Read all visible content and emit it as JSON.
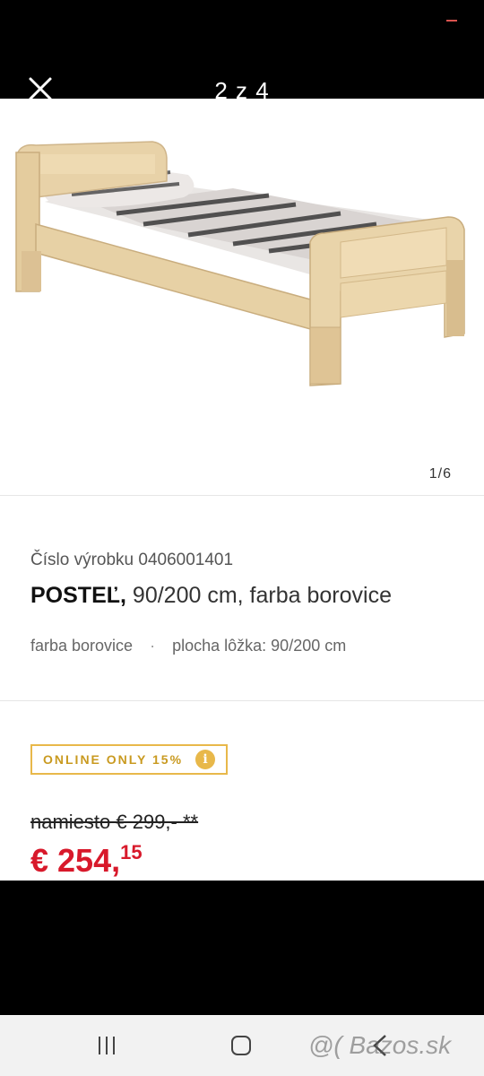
{
  "viewer": {
    "counter": "2 z 4",
    "close_icon": "close-icon",
    "accent_color": "#d9534f"
  },
  "gallery": {
    "image_index": "1/6"
  },
  "product": {
    "code": "Číslo výrobku 0406001401",
    "title_bold": "POSTEĽ,",
    "title_rest": "90/200 cm, farba borovice",
    "attributes": [
      "farba borovice",
      "plocha lôžka: 90/200 cm"
    ],
    "attribute_separator": "·"
  },
  "badge": {
    "text": "ONLINE ONLY 15%",
    "info_glyph": "i",
    "color": "#e8b84a"
  },
  "price": {
    "old": "namiesto € 299,- **",
    "new_main": "€ 254,",
    "new_cents": "15",
    "color": "#d8192b"
  },
  "watermark": "@( Bazos.sk",
  "navbar": {
    "recent_icon": "recent-apps-icon",
    "home_icon": "home-icon",
    "back_icon": "back-icon"
  }
}
